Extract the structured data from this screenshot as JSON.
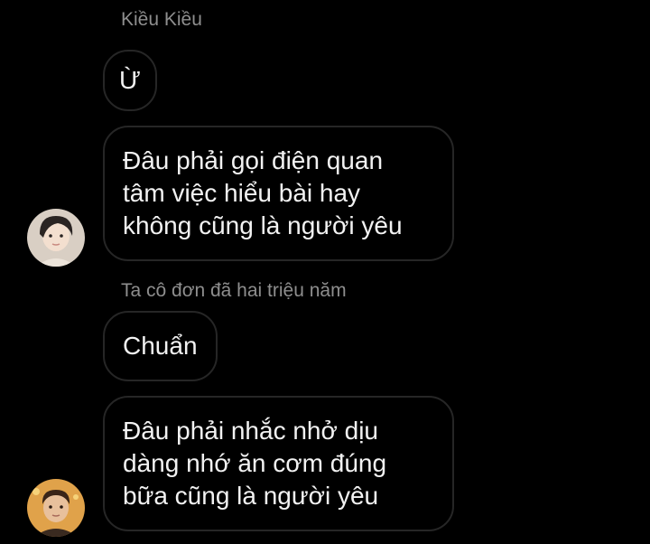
{
  "messages": {
    "group1": {
      "sender": "Kiều Kiều",
      "short_message": "Ừ",
      "long_message": {
        "line1": "Đâu phải gọi điện quan",
        "line2": "tâm việc hiểu bài hay",
        "line3": "không cũng là người yêu"
      },
      "avatar_icon": "user-avatar-icon"
    },
    "group2": {
      "sender": "Ta cô đơn đã hai triệu năm",
      "short_message": "Chuẩn",
      "long_message": {
        "line1": "Đâu phải nhắc nhở dịu",
        "line2": "dàng nhớ ăn cơm đúng",
        "line3": "bữa cũng là người yêu"
      },
      "avatar_icon": "user-avatar-icon"
    }
  },
  "colors": {
    "background": "#000000",
    "bubble_border": "#262626",
    "text": "#f2f2f2",
    "sender_name": "#8e8e8e"
  }
}
